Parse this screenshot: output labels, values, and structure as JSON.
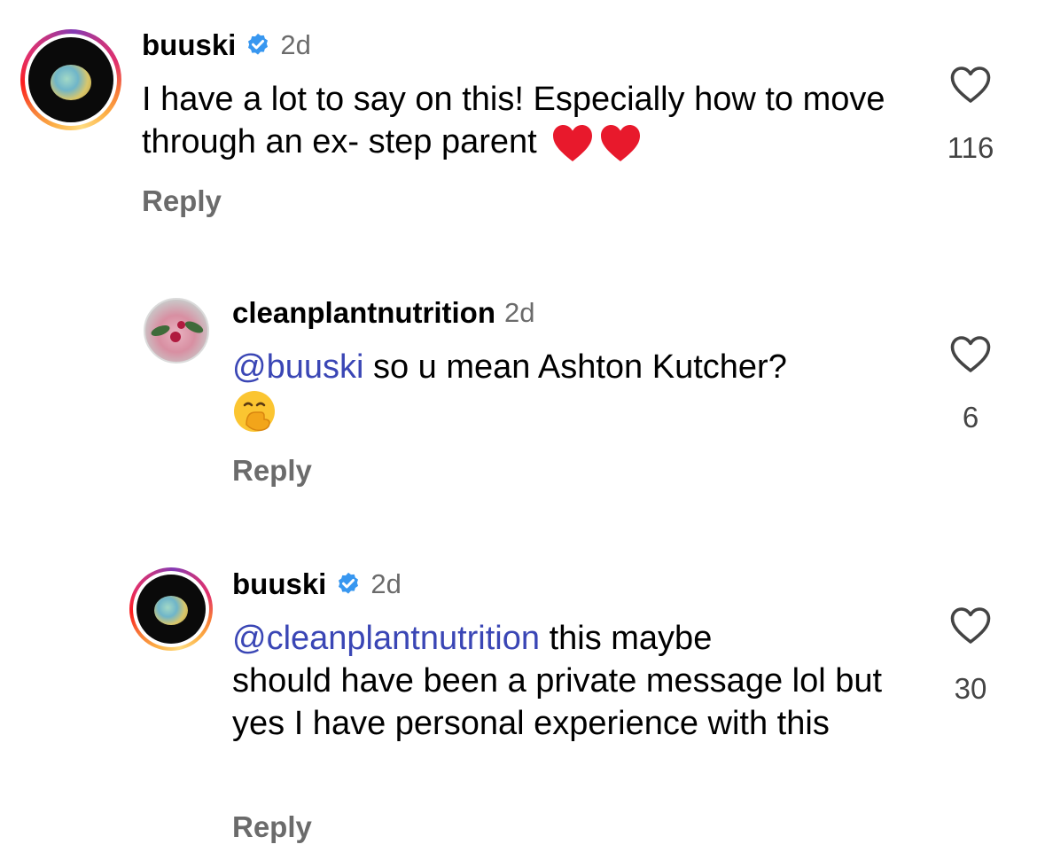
{
  "comments": [
    {
      "username": "buuski",
      "verified": true,
      "time": "2d",
      "text": "I have a lot to say on this! Especially how to move through an ex- step parent",
      "emoji": [
        "red-heart",
        "red-heart"
      ],
      "reply_label": "Reply",
      "likes": "116",
      "avatar_icon": "planet-avatar"
    },
    {
      "username": "cleanplantnutrition",
      "verified": false,
      "time": "2d",
      "mention": "@buuski",
      "text": "so u mean Ashton Kutcher?",
      "emoji": [
        "face-with-hand-over-mouth"
      ],
      "reply_label": "Reply",
      "likes": "6",
      "avatar_icon": "smoothie-avatar"
    },
    {
      "username": "buuski",
      "verified": true,
      "time": "2d",
      "mention": "@cleanplantnutrition",
      "text_line1": "this maybe",
      "text_rest": "should have been a private message lol but yes I have personal experience with this",
      "reply_label": "Reply",
      "likes": "30",
      "avatar_icon": "planet-avatar"
    }
  ],
  "colors": {
    "mention": "#3a46b5",
    "verified_badge": "#3897f0",
    "secondary_text": "#6b6b6b"
  }
}
